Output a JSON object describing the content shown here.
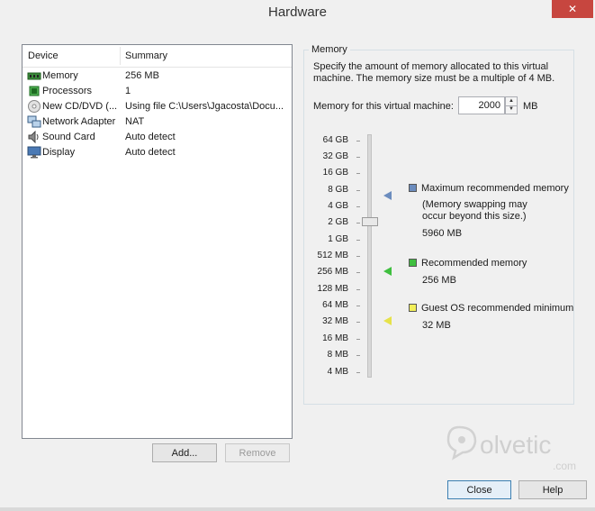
{
  "window": {
    "title": "Hardware",
    "close_glyph": "✕"
  },
  "device_list": {
    "headers": {
      "device": "Device",
      "summary": "Summary"
    },
    "rows": [
      {
        "device": "Memory",
        "summary": "256 MB",
        "icon": "memory-icon"
      },
      {
        "device": "Processors",
        "summary": "1",
        "icon": "processor-icon"
      },
      {
        "device": "New CD/DVD (...",
        "summary": "Using file C:\\Users\\Jgacosta\\Docu...",
        "icon": "cd-dvd-icon"
      },
      {
        "device": "Network Adapter",
        "summary": "NAT",
        "icon": "network-adapter-icon"
      },
      {
        "device": "Sound Card",
        "summary": "Auto detect",
        "icon": "sound-card-icon"
      },
      {
        "device": "Display",
        "summary": "Auto detect",
        "icon": "display-icon"
      }
    ],
    "add_label": "Add...",
    "remove_label": "Remove"
  },
  "memory": {
    "group_title": "Memory",
    "description": "Specify the amount of memory allocated to this virtual machine. The memory size must be a multiple of 4 MB.",
    "field_label": "Memory for this virtual machine:",
    "value": "2000",
    "unit": "MB",
    "scale_labels": [
      "64 GB",
      "32 GB",
      "16 GB",
      "8 GB",
      "4 GB",
      "2 GB",
      "1 GB",
      "512 MB",
      "256 MB",
      "128 MB",
      "64 MB",
      "32 MB",
      "16 MB",
      "8 MB",
      "4 MB"
    ],
    "legend": {
      "max": {
        "label": "Maximum recommended memory",
        "note": "(Memory swapping may occur beyond this size.)",
        "value": "5960 MB",
        "color": "#6b8cbe"
      },
      "recommended": {
        "label": "Recommended memory",
        "value": "256 MB",
        "color": "#3fbf3f"
      },
      "guest_min": {
        "label": "Guest OS recommended minimum",
        "value": "32 MB",
        "color": "#f2ef5a"
      }
    }
  },
  "footer": {
    "close_label": "Close",
    "help_label": "Help"
  },
  "watermark": {
    "text": "olvetic",
    "suffix": ".com"
  }
}
